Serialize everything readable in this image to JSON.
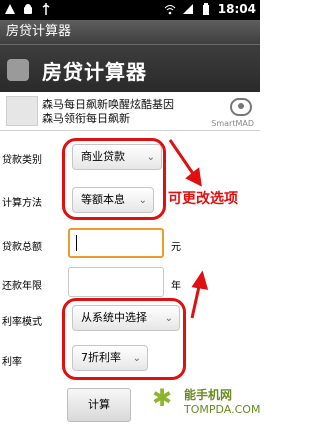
{
  "status_bar": {
    "time": "18:04"
  },
  "window_title": "房贷计算器",
  "app_title": "房贷计算器",
  "ad": {
    "line1": "森马每日飙新唤醒炫酷基因",
    "line2": "森马领衔每日飙新",
    "brand": "SmartMAD"
  },
  "form": {
    "loan_type": {
      "label": "贷款类别",
      "value": "商业贷款"
    },
    "calc_method": {
      "label": "计算方法",
      "value": "等额本息"
    },
    "total_loan": {
      "label": "贷款总额",
      "value": "",
      "unit": "元"
    },
    "years": {
      "label": "还款年限",
      "value": "",
      "unit": "年"
    },
    "rate_mode": {
      "label": "利率模式",
      "value": "从系统中选择"
    },
    "rate": {
      "label": "利率",
      "value": "7折利率"
    },
    "calculate_button": "计算"
  },
  "annotation": {
    "note": "可更改选项",
    "color": "#e01010"
  },
  "watermark": {
    "cn": "能手机网",
    "en": "TOMPDA.COM"
  }
}
